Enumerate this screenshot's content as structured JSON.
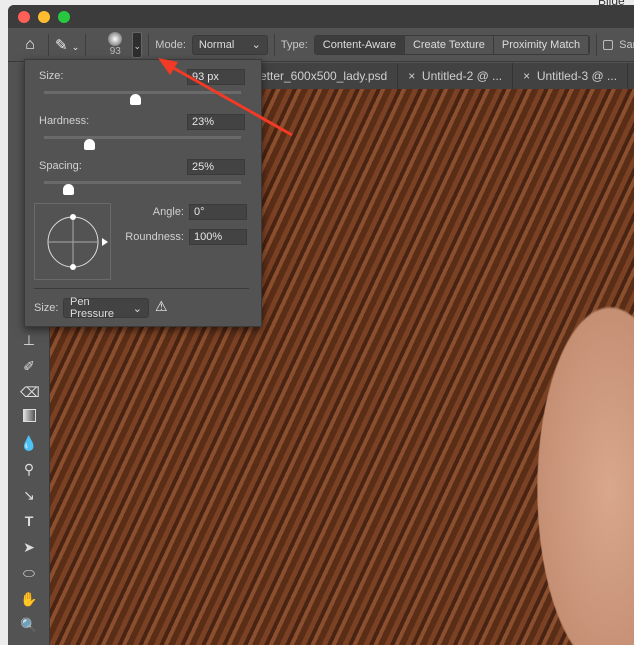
{
  "window": {
    "traffic_colors": [
      "#fe5f57",
      "#febc2e",
      "#28c840"
    ],
    "outside_text": "Bilde"
  },
  "options": {
    "brush_size": "93",
    "mode_label": "Mode:",
    "mode_value": "Normal",
    "type_label": "Type:",
    "types": [
      "Content-Aware",
      "Create Texture",
      "Proximity Match"
    ],
    "active_type": "Content-Aware",
    "sample_label": "Sam"
  },
  "tabs": [
    "etter_600x500_lady.psd",
    "Untitled-2 @ ...",
    "Untitled-3 @ ..."
  ],
  "panel": {
    "size_label": "Size:",
    "size_value": "93 px",
    "size_pct": 46,
    "hardness_label": "Hardness:",
    "hardness_value": "23%",
    "hardness_pct": 23,
    "spacing_label": "Spacing:",
    "spacing_value": "25%",
    "spacing_pct": 12,
    "angle_label": "Angle:",
    "angle_value": "0°",
    "roundness_label": "Roundness:",
    "roundness_value": "100%",
    "control_label": "Size:",
    "control_value": "Pen Pressure"
  },
  "annotation": {
    "arrow_color": "#f23a24"
  }
}
